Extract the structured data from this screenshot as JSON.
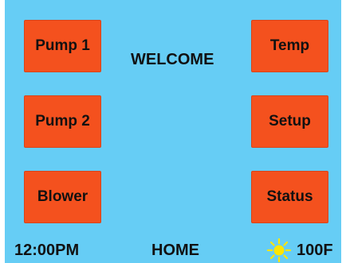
{
  "screen": {
    "background_color": "#66cdf5",
    "button_color": "#f4511e",
    "welcome_text": "WELCOME"
  },
  "left_buttons": [
    {
      "label": "Pump 1"
    },
    {
      "label": "Pump 2"
    },
    {
      "label": "Blower"
    }
  ],
  "right_buttons": [
    {
      "label": "Temp"
    },
    {
      "label": "Setup"
    },
    {
      "label": "Status"
    }
  ],
  "status_bar": {
    "time": "12:00PM",
    "page": "HOME",
    "weather_icon": "sun-icon",
    "temperature": "100F"
  }
}
